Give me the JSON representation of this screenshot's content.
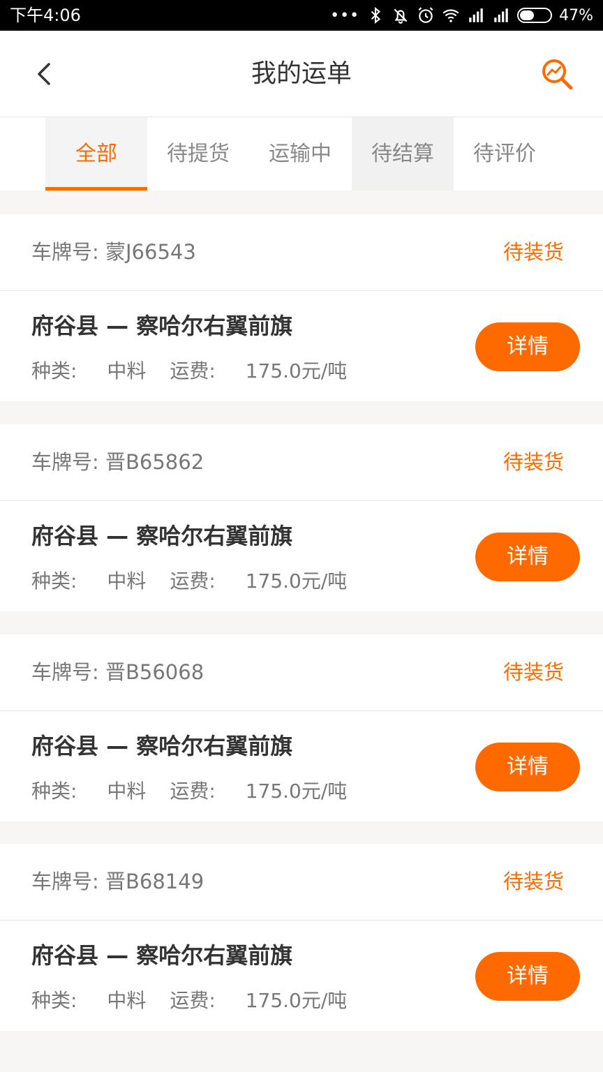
{
  "status_bar": {
    "time": "下午4:06",
    "battery": "47%",
    "battery_level": 0.47
  },
  "header": {
    "title": "我的运单",
    "back_icon": "chevron-left-icon",
    "search_icon": "search-chart-icon"
  },
  "tabs": [
    {
      "label": "全部",
      "active": true
    },
    {
      "label": "待提货",
      "active": false
    },
    {
      "label": "运输中",
      "active": false
    },
    {
      "label": "待结算",
      "active": false
    },
    {
      "label": "待评价",
      "active": false
    }
  ],
  "orders": [
    {
      "plate_label": "车牌号:",
      "plate": "蒙J66543",
      "status": "待装货",
      "route": "府谷县 — 察哈尔右翼前旗",
      "category_label": "种类:",
      "category": "中料",
      "fee_label": "运费:",
      "fee": "175.0元/吨",
      "button": "详情"
    },
    {
      "plate_label": "车牌号:",
      "plate": "晋B65862",
      "status": "待装货",
      "route": "府谷县 — 察哈尔右翼前旗",
      "category_label": "种类:",
      "category": "中料",
      "fee_label": "运费:",
      "fee": "175.0元/吨",
      "button": "详情"
    },
    {
      "plate_label": "车牌号:",
      "plate": "晋B56068",
      "status": "待装货",
      "route": "府谷县 — 察哈尔右翼前旗",
      "category_label": "种类:",
      "category": "中料",
      "fee_label": "运费:",
      "fee": "175.0元/吨",
      "button": "详情"
    },
    {
      "plate_label": "车牌号:",
      "plate": "晋B68149",
      "status": "待装货",
      "route": "府谷县 — 察哈尔右翼前旗",
      "category_label": "种类:",
      "category": "中料",
      "fee_label": "运费:",
      "fee": "175.0元/吨",
      "button": "详情"
    }
  ],
  "colors": {
    "accent": "#ff6a00",
    "text_dark": "#333333",
    "text_muted": "#777777",
    "background": "#f7f6f4"
  }
}
